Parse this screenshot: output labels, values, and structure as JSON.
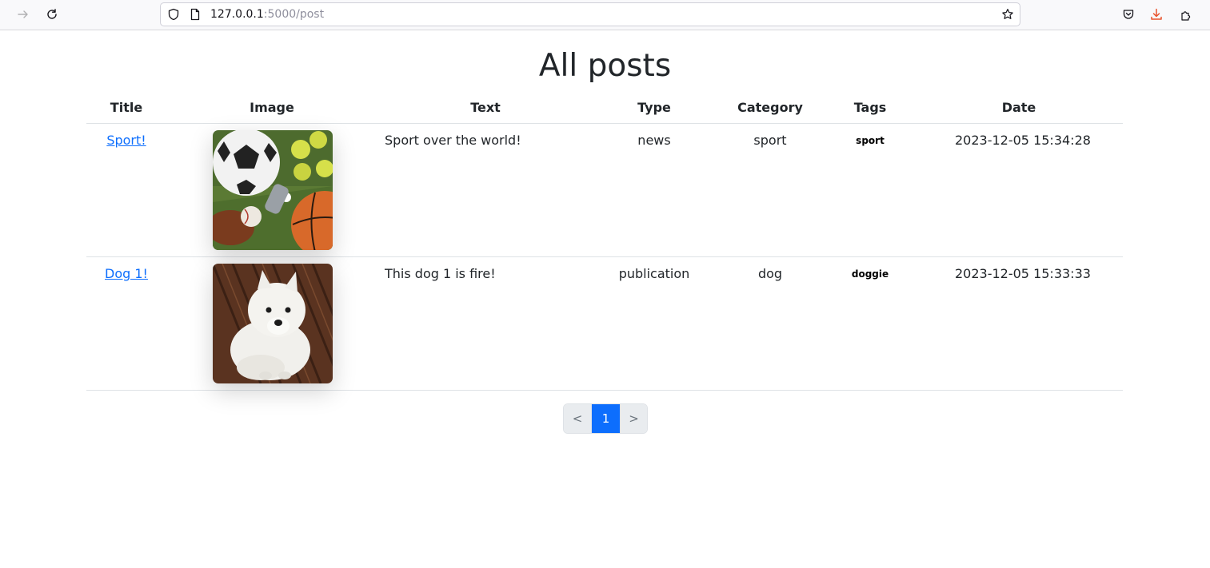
{
  "browser": {
    "url_host": "127.0.0.1",
    "url_path": ":5000/post",
    "icons": [
      "forward-arrow-icon",
      "reload-icon",
      "shield-icon",
      "page-icon",
      "bookmark-star-icon",
      "pocket-icon",
      "download-icon",
      "extensions-icon"
    ],
    "download_color": "#e8542e"
  },
  "page": {
    "title": "All posts"
  },
  "table": {
    "headers": {
      "title": "Title",
      "image": "Image",
      "text": "Text",
      "type": "Type",
      "category": "Category",
      "tags": "Tags",
      "date": "Date"
    },
    "rows": [
      {
        "title": "Sport!",
        "image": "sports-balls-image",
        "text": "Sport over the world!",
        "type": "news",
        "category": "sport",
        "tags": "sport",
        "date": "2023-12-05 15:34:28"
      },
      {
        "title": "Dog 1!",
        "image": "white-dog-image",
        "text": "This dog 1 is fire!",
        "type": "publication",
        "category": "dog",
        "tags": "doggie",
        "date": "2023-12-05 15:33:33"
      }
    ]
  },
  "pagination": {
    "prev": "<",
    "current": "1",
    "next": ">",
    "active_color": "#0d6efd"
  }
}
